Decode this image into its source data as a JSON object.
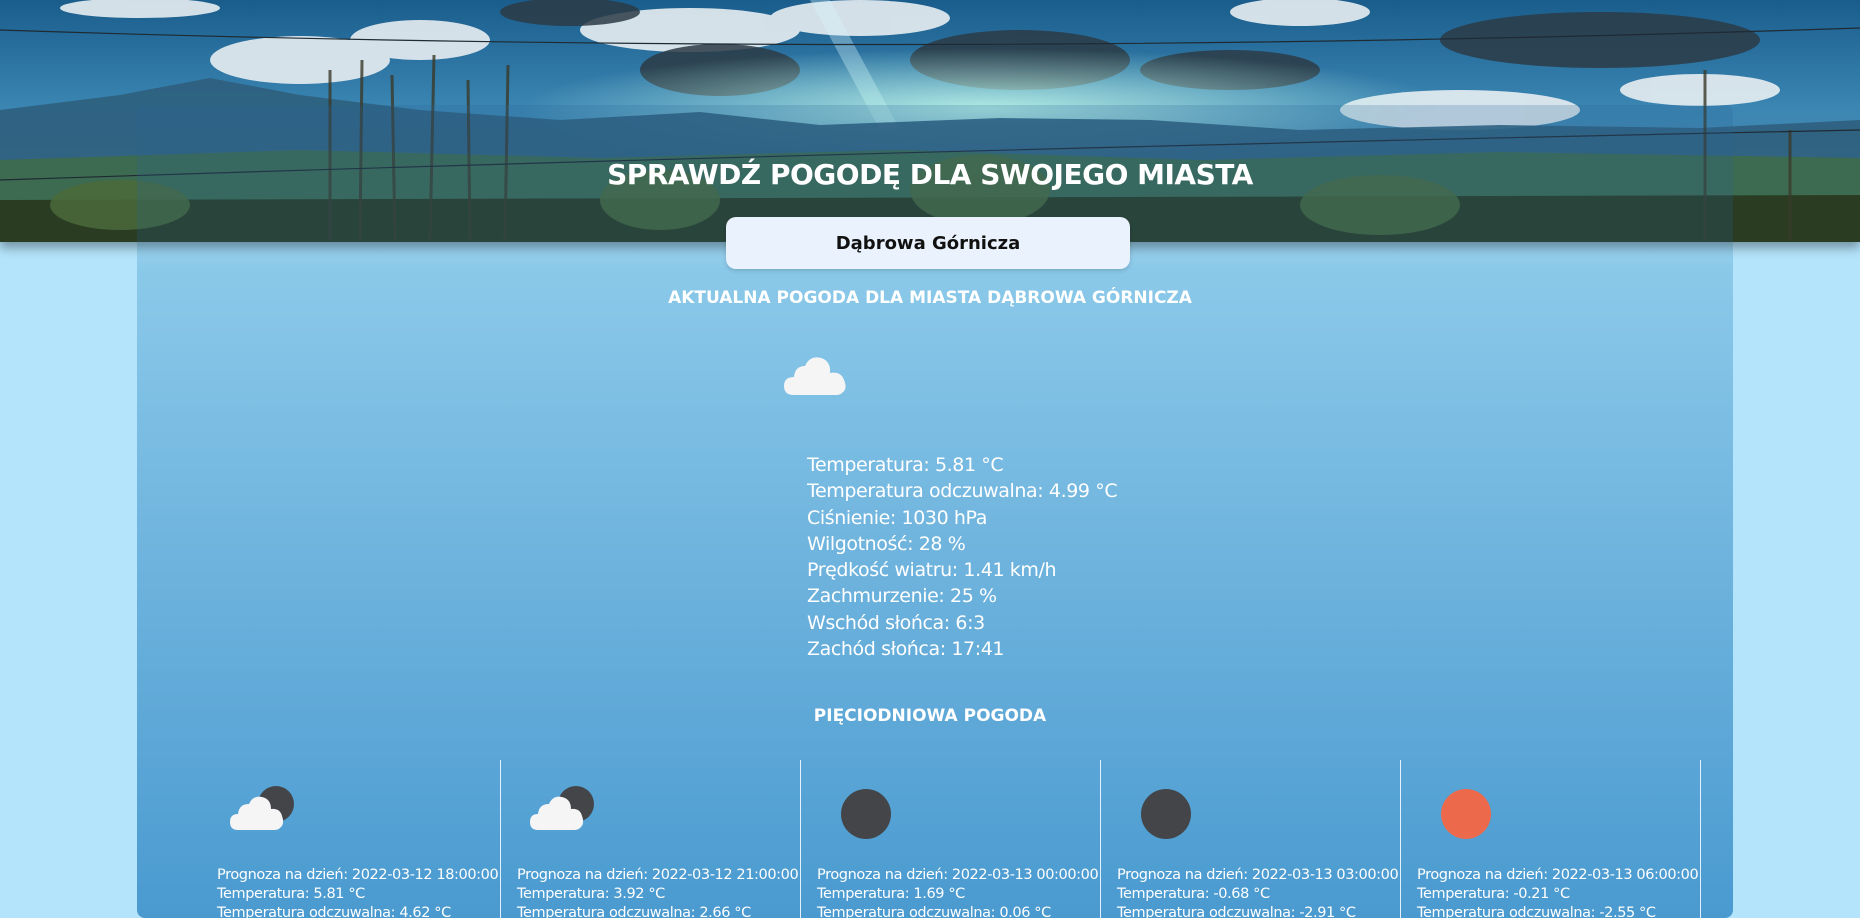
{
  "header": {
    "title": "SPRAWDŹ POGODĘ DLA SWOJEGO MIASTA"
  },
  "search": {
    "value": "Dąbrowa Górnicza"
  },
  "current": {
    "heading": "AKTUALNA POGODA DLA MIASTA DĄBROWA GÓRNICZA",
    "icon": "cloud-icon",
    "temperature": "Temperatura: 5.81 °C",
    "feels_like": "Temperatura odczuwalna: 4.99 °C",
    "pressure": "Ciśnienie: 1030 hPa",
    "humidity": "Wilgotność: 28 %",
    "wind_speed": "Prędkość wiatru: 1.41 km/h",
    "clouds": "Zachmurzenie: 25 %",
    "sunrise": "Wschód słońca: 6:3",
    "sunset": "Zachód słońca: 17:41"
  },
  "forecast": {
    "heading": "PIĘCIODNIOWA POGODA",
    "days": [
      {
        "icon": "cloud-moon-icon",
        "date": "Prognoza na dzień: 2022-03-12 18:00:00",
        "temperature": "Temperatura: 5.81 °C",
        "feels_like": "Temperatura odczuwalna: 4.62 °C"
      },
      {
        "icon": "cloud-moon-icon",
        "date": "Prognoza na dzień: 2022-03-12 21:00:00",
        "temperature": "Temperatura: 3.92 °C",
        "feels_like": "Temperatura odczuwalna: 2.66 °C"
      },
      {
        "icon": "moon-icon",
        "date": "Prognoza na dzień: 2022-03-13 00:00:00",
        "temperature": "Temperatura: 1.69 °C",
        "feels_like": "Temperatura odczuwalna: 0.06 °C"
      },
      {
        "icon": "moon-icon",
        "date": "Prognoza na dzień: 2022-03-13 03:00:00",
        "temperature": "Temperatura: -0.68 °C",
        "feels_like": "Temperatura odczuwalna: -2.91 °C"
      },
      {
        "icon": "sun-icon",
        "date": "Prognoza na dzień: 2022-03-13 06:00:00",
        "temperature": "Temperatura: -0.21 °C",
        "feels_like": "Temperatura odczuwalna: -2.55 °C"
      }
    ]
  },
  "colors": {
    "page_background": "#b4e4fb",
    "panel_blue": "#6fb4de",
    "search_background": "#eaf2fd",
    "moon_dark": "#434549",
    "sun_orange": "#ec6a4b",
    "cloud_white": "#f5f5f5"
  }
}
